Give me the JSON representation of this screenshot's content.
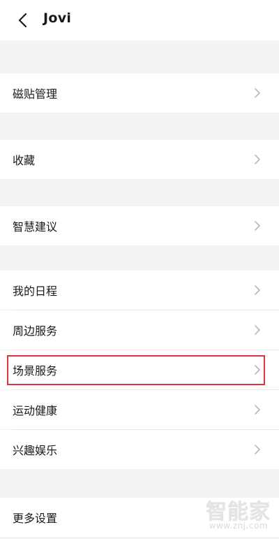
{
  "header": {
    "title": "Jovi"
  },
  "menu": {
    "tile_management": "磁贴管理",
    "favorites": "收藏",
    "smart_suggestions": "智慧建议",
    "my_schedule": "我的日程",
    "nearby_services": "周边服务",
    "scene_services": "场景服务",
    "fitness_health": "运动健康",
    "interest_entertainment": "兴趣娱乐",
    "more_settings": "更多设置"
  },
  "watermark": {
    "title": "智能家",
    "url": "www.znj.com"
  },
  "colors": {
    "background": "#f3f3f3",
    "card": "#ffffff",
    "highlight": "#d9363e",
    "chevron": "#b8b8b8"
  },
  "icons": {
    "back": "back-arrow-icon",
    "chevron": "chevron-right-icon"
  }
}
